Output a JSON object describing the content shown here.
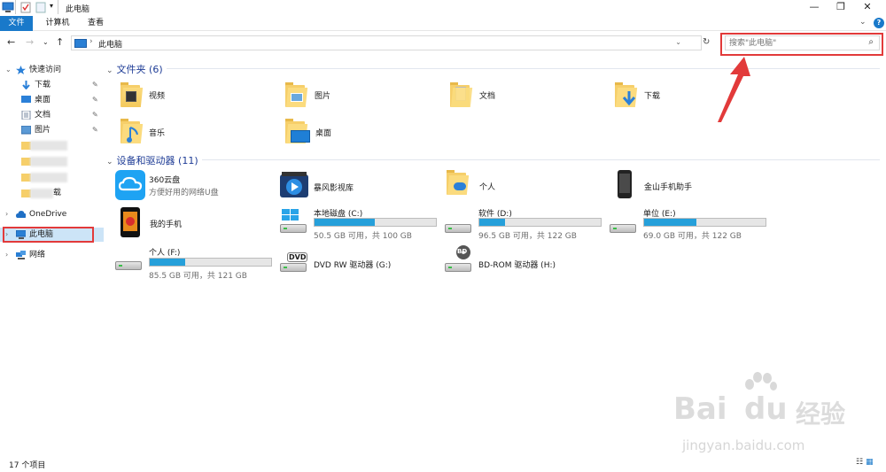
{
  "window": {
    "title": "此电脑",
    "controls": {
      "minimize": "—",
      "restore": "❐",
      "close": "✕"
    }
  },
  "ribbon": {
    "tabs": [
      "文件",
      "计算机",
      "查看"
    ],
    "help": "?"
  },
  "address": {
    "crumb": "此电脑",
    "refresh": "↻"
  },
  "search": {
    "placeholder": "搜索\"此电脑\""
  },
  "sidebar": {
    "quick_access": "快速访问",
    "pinned": [
      "下载",
      "桌面",
      "文档",
      "图片"
    ],
    "onedrive": "OneDrive",
    "this_pc": "此电脑",
    "network": "网络",
    "blurred_last_suffix": "载"
  },
  "folders": {
    "header": "文件夹 (6)",
    "items": [
      "视频",
      "图片",
      "文档",
      "下载",
      "音乐",
      "桌面"
    ]
  },
  "devices": {
    "header": "设备和驱动器 (11)",
    "apps": [
      {
        "name": "360云盘",
        "sub": "方便好用的网络U盘"
      },
      {
        "name": "暴风影视库"
      },
      {
        "name": "个人"
      },
      {
        "name": "金山手机助手"
      },
      {
        "name": "我的手机"
      }
    ],
    "drives": [
      {
        "name": "本地磁盘 (C:)",
        "free": "50.5 GB 可用，共 100 GB",
        "used_fraction": 0.495
      },
      {
        "name": "软件 (D:)",
        "free": "96.5 GB 可用，共 122 GB",
        "used_fraction": 0.209
      },
      {
        "name": "单位 (E:)",
        "free": "69.0 GB 可用，共 122 GB",
        "used_fraction": 0.434
      },
      {
        "name": "个人 (F:)",
        "free": "85.5 GB 可用，共 121 GB",
        "used_fraction": 0.293
      }
    ],
    "optical": [
      {
        "name": "DVD RW 驱动器 (G:)",
        "badge": "DVD"
      },
      {
        "name": "BD-ROM 驱动器 (H:)",
        "badge": "BD"
      }
    ]
  },
  "status": {
    "count": "17 个项目"
  },
  "watermark": {
    "brand": "Bai",
    "brand2": "du",
    "cn": "经验",
    "url": "jingyan.baidu.com"
  },
  "colors": {
    "accent": "#1979ca",
    "highlight": "#e23a3a",
    "bar_fill": "#26a0da",
    "selected": "#cce4f7"
  }
}
